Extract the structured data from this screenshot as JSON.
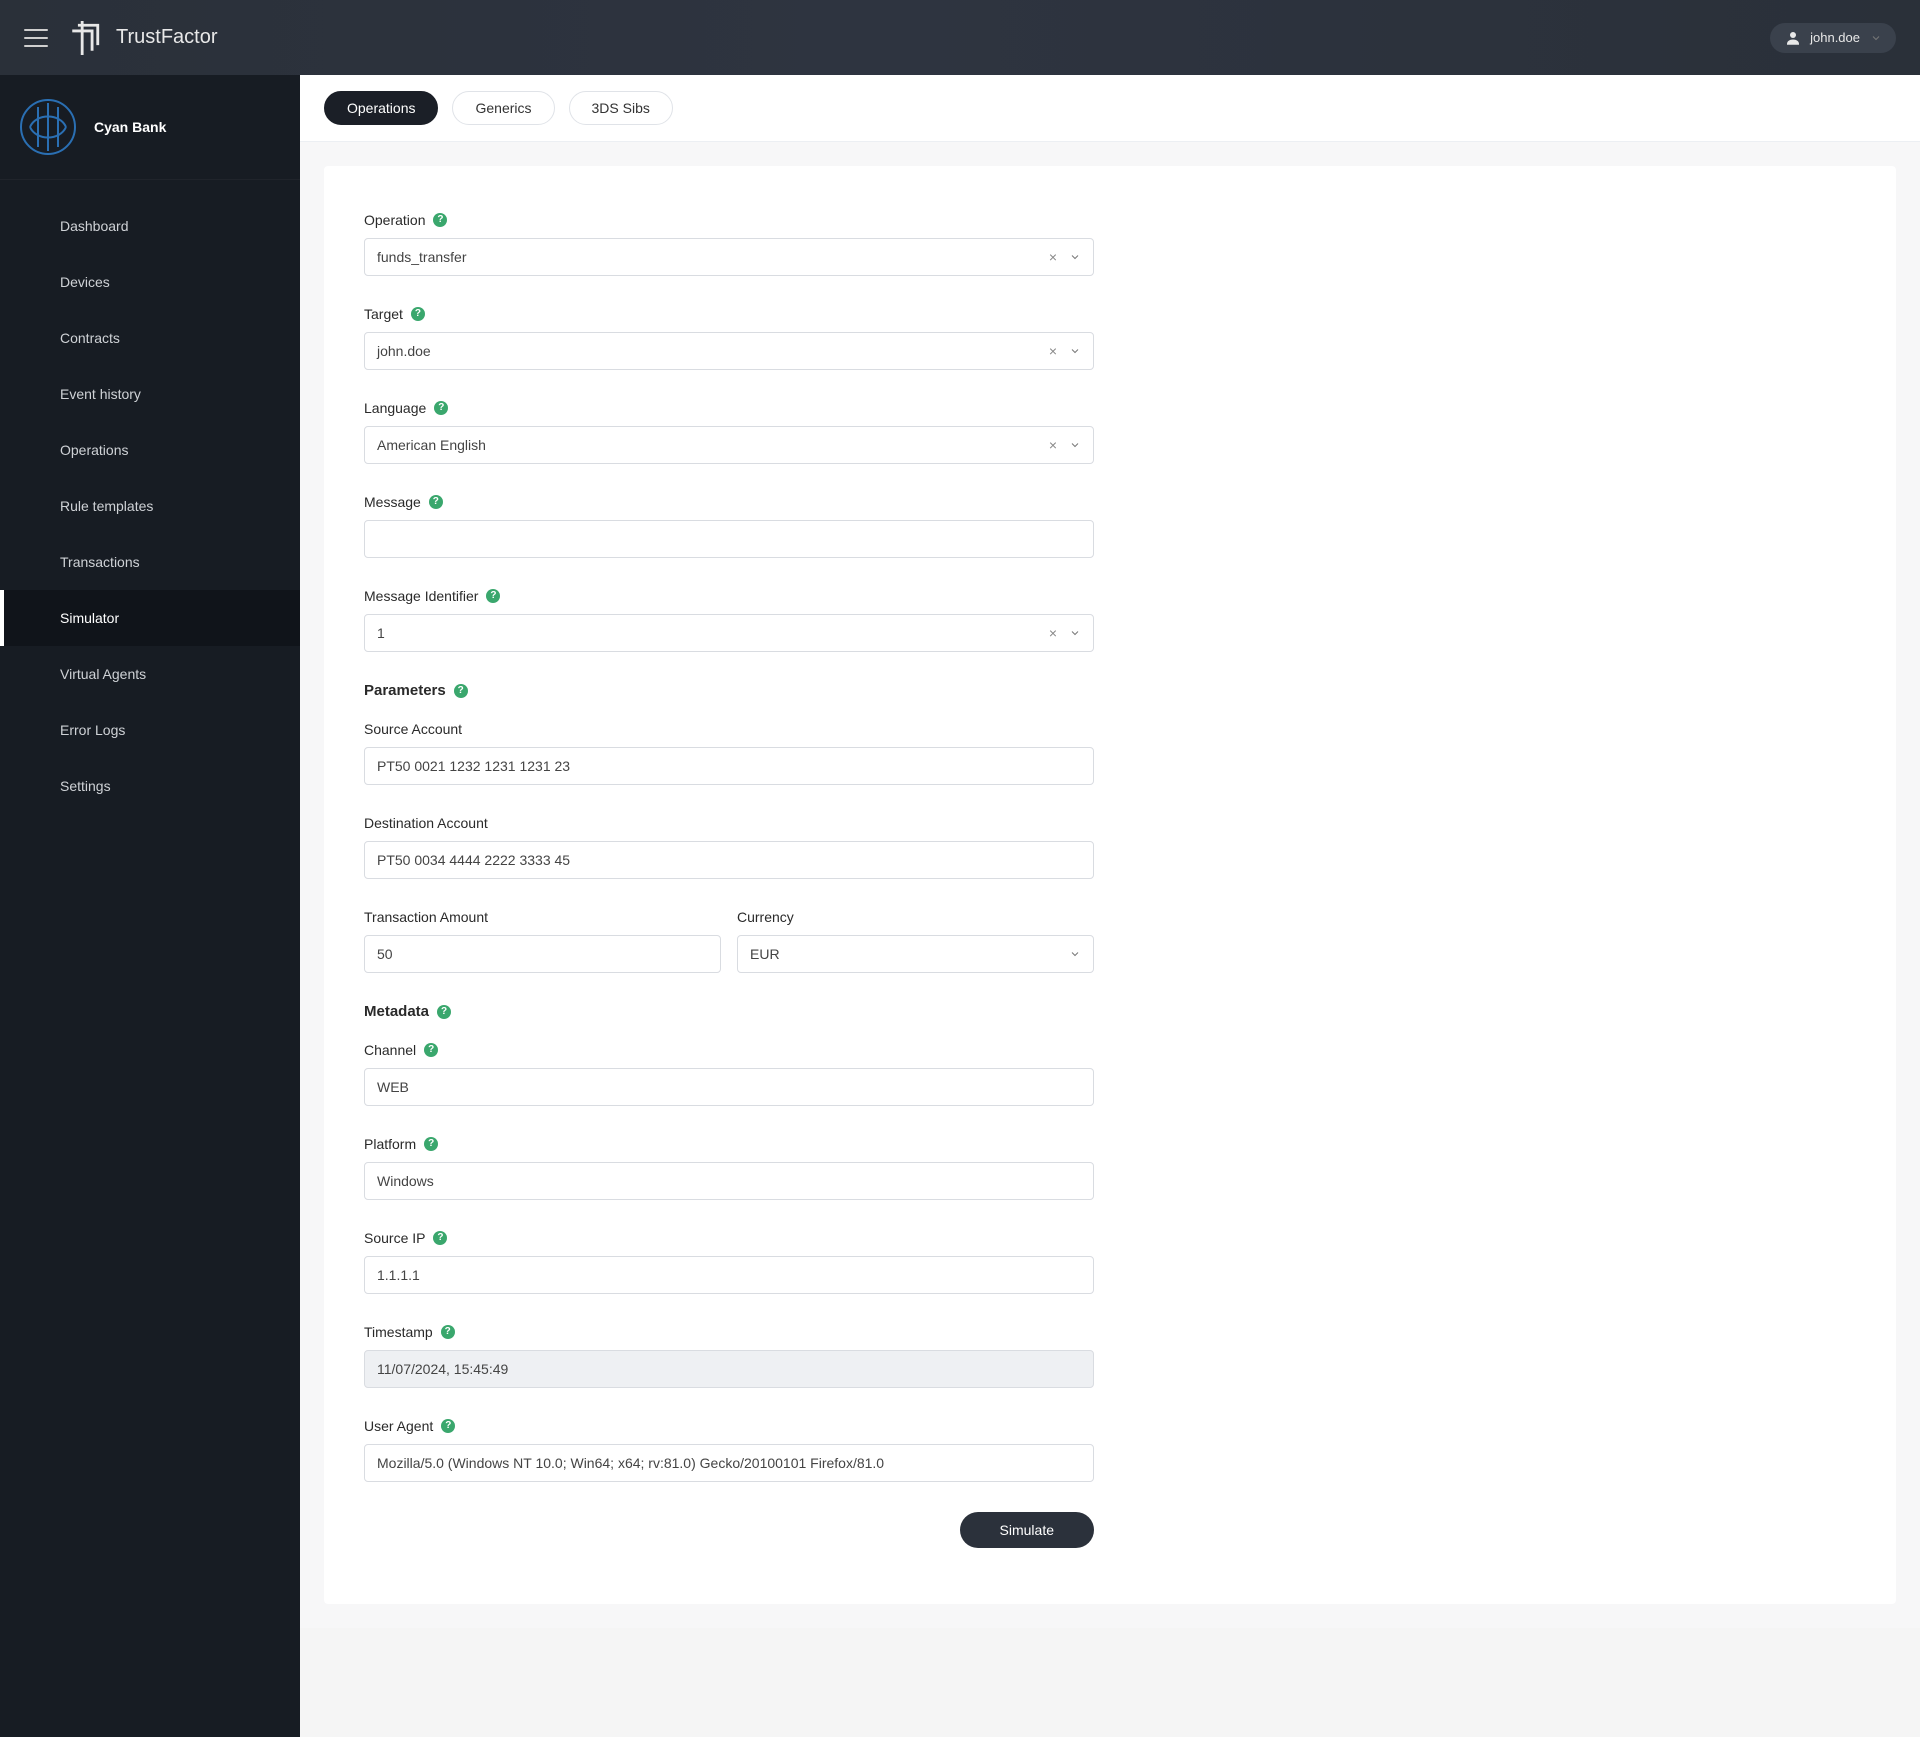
{
  "header": {
    "brand": "TrustFactor",
    "user": "john.doe"
  },
  "sidebar": {
    "org_name": "Cyan Bank",
    "items": [
      {
        "label": "Dashboard"
      },
      {
        "label": "Devices"
      },
      {
        "label": "Contracts"
      },
      {
        "label": "Event history"
      },
      {
        "label": "Operations"
      },
      {
        "label": "Rule templates"
      },
      {
        "label": "Transactions"
      },
      {
        "label": "Simulator",
        "active": true
      },
      {
        "label": "Virtual Agents"
      },
      {
        "label": "Error Logs"
      },
      {
        "label": "Settings"
      }
    ]
  },
  "tabs": [
    {
      "label": "Operations",
      "active": true
    },
    {
      "label": "Generics"
    },
    {
      "label": "3DS Sibs"
    }
  ],
  "form": {
    "operation": {
      "label": "Operation",
      "value": "funds_transfer"
    },
    "target": {
      "label": "Target",
      "value": "john.doe"
    },
    "language": {
      "label": "Language",
      "value": "American English"
    },
    "message": {
      "label": "Message",
      "value": ""
    },
    "message_identifier": {
      "label": "Message Identifier",
      "value": "1"
    },
    "parameters_section": "Parameters",
    "source_account": {
      "label": "Source Account",
      "value": "PT50 0021 1232 1231 1231 23"
    },
    "destination_account": {
      "label": "Destination Account",
      "value": "PT50 0034 4444 2222 3333 45"
    },
    "transaction_amount": {
      "label": "Transaction Amount",
      "value": "50"
    },
    "currency": {
      "label": "Currency",
      "value": "EUR"
    },
    "metadata_section": "Metadata",
    "channel": {
      "label": "Channel",
      "value": "WEB"
    },
    "platform": {
      "label": "Platform",
      "value": "Windows"
    },
    "source_ip": {
      "label": "Source IP",
      "value": "1.1.1.1"
    },
    "timestamp": {
      "label": "Timestamp",
      "value": "11/07/2024, 15:45:49"
    },
    "user_agent": {
      "label": "User Agent",
      "value": "Mozilla/5.0 (Windows NT 10.0; Win64; x64; rv:81.0) Gecko/20100101 Firefox/81.0"
    },
    "submit_label": "Simulate"
  }
}
